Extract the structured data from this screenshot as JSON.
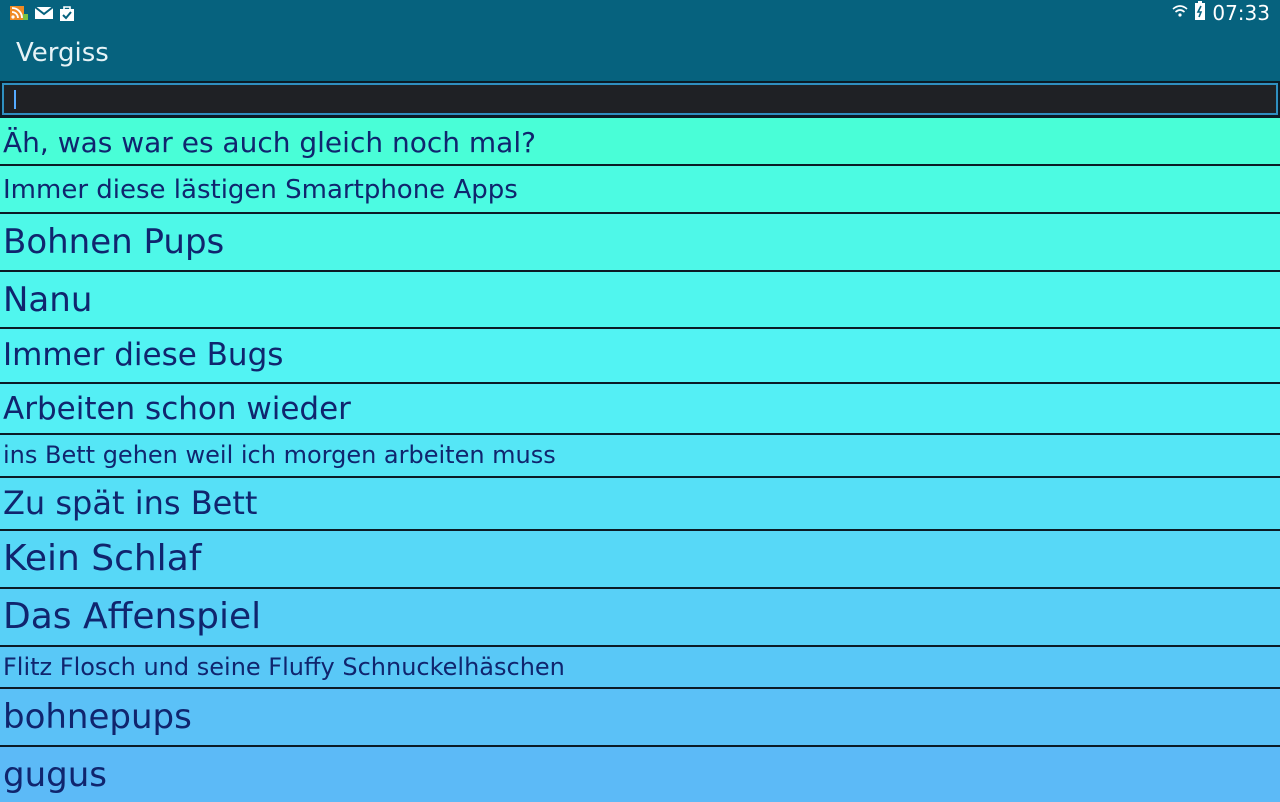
{
  "status": {
    "time": "07:33"
  },
  "app": {
    "title": "Vergiss"
  },
  "search": {
    "value": ""
  },
  "list": {
    "items": [
      "Äh, was war es auch gleich noch mal?",
      "Immer diese lästigen Smartphone Apps",
      "Bohnen Pups",
      "Nanu",
      "Immer diese Bugs",
      "Arbeiten schon wieder",
      "ins Bett gehen weil ich morgen arbeiten muss",
      "Zu spät ins Bett",
      "Kein Schlaf",
      "Das Affenspiel",
      "Flitz Flosch und seine Fluffy Schnuckelhäschen",
      "bohnepups",
      "gugus"
    ]
  }
}
